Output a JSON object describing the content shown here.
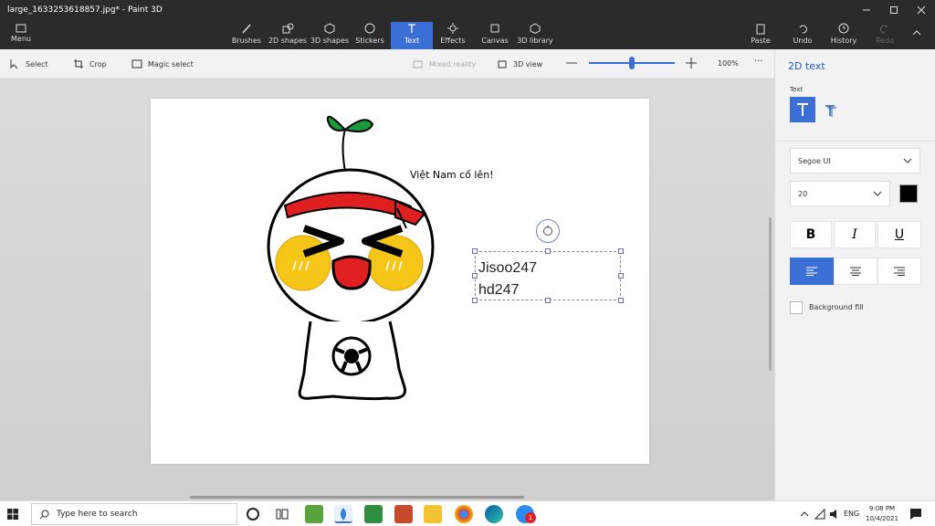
{
  "window": {
    "title": "large_1633253618857.jpg* - Paint 3D"
  },
  "toolbar": {
    "menu_label": "Menu",
    "tools": [
      "Brushes",
      "2D shapes",
      "3D shapes",
      "Stickers",
      "Text",
      "Effects",
      "Canvas",
      "3D library"
    ],
    "paste_label": "Paste",
    "undo_label": "Undo",
    "history_label": "History",
    "redo_label": "Redo"
  },
  "subtoolbar": {
    "select_label": "Select",
    "crop_label": "Crop",
    "magic_select_label": "Magic select",
    "mixed_reality_label": "Mixed reality",
    "view3d_label": "3D view",
    "zoom_level": "100%",
    "zoom_fraction": 0.5,
    "more_label": "···"
  },
  "canvas": {
    "caption_text": "Việt Nam cố lên!",
    "textbox_lines": [
      "Jisoo247",
      "hd247"
    ]
  },
  "panel": {
    "title": "2D text",
    "text_section_label": "Text",
    "font_name": "Segoe UI",
    "font_size": "20",
    "text_color": "#000000",
    "bold_label": "B",
    "italic_label": "I",
    "underline_label": "U",
    "background_fill_label": "Background fill",
    "accent_color": "#3b6fd6"
  },
  "taskbar": {
    "search_placeholder": "Type here to search",
    "language": "ENG",
    "time": "9:08 PM",
    "date": "10/4/2021",
    "notification_count": "1"
  }
}
